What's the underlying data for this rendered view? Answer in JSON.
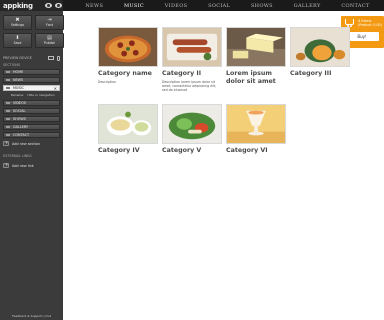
{
  "sidebar": {
    "logo": "appking",
    "tools": [
      {
        "label": "Settings",
        "icon": "✖"
      },
      {
        "label": "Font",
        "icon": "⇥"
      },
      {
        "label": "Save",
        "icon": "⬇"
      },
      {
        "label": "Publish",
        "icon": "▤"
      }
    ],
    "preview_label": "PREVIEW DEVICE",
    "sections_label": "SECTIONS",
    "sections": [
      {
        "label": "HOME",
        "active": false
      },
      {
        "label": "NEWS",
        "active": false
      },
      {
        "label": "MUSIC",
        "active": true
      },
      {
        "label": "VIDEOS",
        "active": false
      },
      {
        "label": "SOCIAL",
        "active": false
      },
      {
        "label": "SHOWS",
        "active": false
      },
      {
        "label": "GALLERY",
        "active": false
      },
      {
        "label": "CONTACT",
        "active": false
      }
    ],
    "subtabs": [
      "Rename",
      "Hide in navigation"
    ],
    "add_section": "Add new section",
    "external_label": "EXTERNAL LINKS",
    "add_link": "Add new link",
    "footer": "Feedback & Support  |  Out"
  },
  "topnav": {
    "items": [
      "NEWS",
      "MUSIC",
      "VIDEOS",
      "SOCIAL",
      "SHOWS",
      "GALLERY",
      "CONTACT"
    ],
    "active_index": 1
  },
  "cart": {
    "items": "4 items",
    "total": "(Product: 0,00)",
    "buy_label": "Buy!",
    "color": "#f39a12"
  },
  "categories": [
    {
      "title": "Category name",
      "desc": "Description"
    },
    {
      "title": "Category II",
      "desc": "Description lorem ipsum dolor sit amet, consectetur adipisicing elit, sed do eiusmod"
    },
    {
      "title": "Lorem ipsum dolor sit amet",
      "desc": ""
    },
    {
      "title": "Category III",
      "desc": ""
    },
    {
      "title": "Category IV",
      "desc": ""
    },
    {
      "title": "Category V",
      "desc": ""
    },
    {
      "title": "Category VI",
      "desc": ""
    }
  ]
}
